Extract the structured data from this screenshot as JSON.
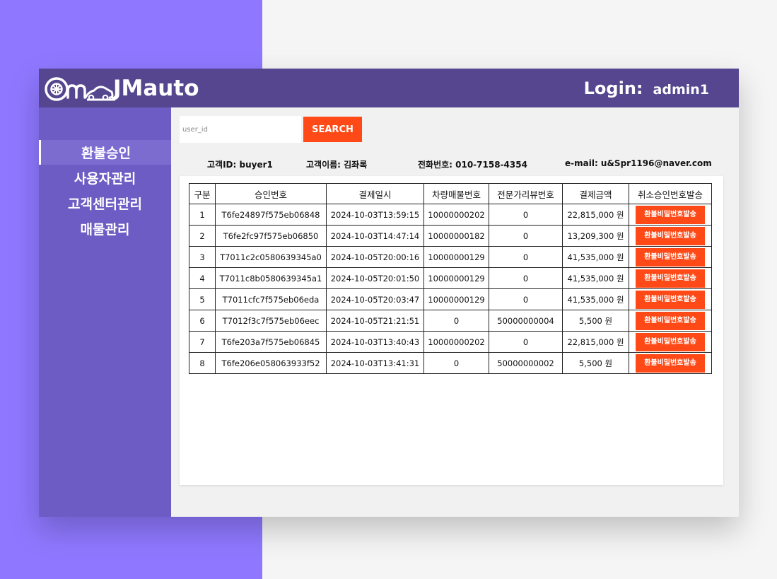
{
  "app": {
    "brand": "JMauto"
  },
  "header": {
    "login_label": "Login:",
    "username": "admin1"
  },
  "sidebar": {
    "items": [
      {
        "label": "환불승인",
        "active": true
      },
      {
        "label": "사용자관리",
        "active": false
      },
      {
        "label": "고객센터관리",
        "active": false
      },
      {
        "label": "매물관리",
        "active": false
      }
    ]
  },
  "search": {
    "placeholder": "user_id",
    "value": "",
    "button_label": "SEARCH"
  },
  "customer": {
    "id": "고객ID: buyer1",
    "name": "고객이름: 김좌록",
    "phone": "전화번호: 010-7158-4354",
    "email": "e-mail: u&Spr1196@naver.com"
  },
  "table": {
    "headers": [
      "구분",
      "승인번호",
      "결제일시",
      "차량매물번호",
      "전문가리뷰번호",
      "결제금액",
      "취소승인번호발송"
    ],
    "rows": [
      [
        "1",
        "T6fe24897f575eb06848",
        "2024-10-03T13:59:15",
        "10000000202",
        "0",
        "22,815,000 원",
        "환불비밀번호발송"
      ],
      [
        "2",
        "T6fe2fc97f575eb06850",
        "2024-10-03T14:47:14",
        "10000000182",
        "0",
        "13,209,300 원",
        "환불비밀번호발송"
      ],
      [
        "3",
        "T7011c2c0580639345a0",
        "2024-10-05T20:00:16",
        "10000000129",
        "0",
        "41,535,000 원",
        "환불비밀번호발송"
      ],
      [
        "4",
        "T7011c8b0580639345a1",
        "2024-10-05T20:01:50",
        "10000000129",
        "0",
        "41,535,000 원",
        "환불비밀번호발송"
      ],
      [
        "5",
        "T7011cfc7f575eb06eda",
        "2024-10-05T20:03:47",
        "10000000129",
        "0",
        "41,535,000 원",
        "환불비밀번호발송"
      ],
      [
        "6",
        "T7012f3c7f575eb06eec",
        "2024-10-05T21:21:51",
        "0",
        "50000000004",
        "5,500 원",
        "환불비밀번호발송"
      ],
      [
        "7",
        "T6fe203a7f575eb06845",
        "2024-10-03T13:40:43",
        "10000000202",
        "0",
        "22,815,000 원",
        "환불비밀번호발송"
      ],
      [
        "8",
        "T6fe206e058063933f52",
        "2024-10-03T13:41:31",
        "0",
        "50000000002",
        "5,500 원",
        "환불비밀번호발송"
      ]
    ]
  },
  "colors": {
    "accent_orange": "#ff4a17",
    "header_purple": "#55468f",
    "sidebar_purple": "#6d5cc4",
    "background_purple": "#8f78ff"
  },
  "icons": {
    "logo": "car-wheel-logo-icon"
  }
}
